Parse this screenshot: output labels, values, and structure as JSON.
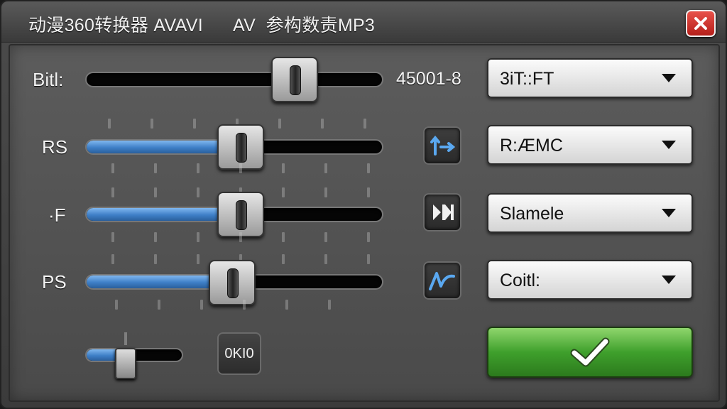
{
  "window": {
    "title": "动漫360转换器 AVAVI      AV  参构数责MP3",
    "close_icon": "close-x-icon"
  },
  "rows": [
    {
      "label": "Bitl:",
      "slider_level": 0.62,
      "has_fill": false
    },
    {
      "label": "RS",
      "slider_level": 0.45,
      "has_fill": true
    },
    {
      "label": "·F",
      "slider_level": 0.45,
      "has_fill": true
    },
    {
      "label": "PS",
      "slider_level": 0.42,
      "has_fill": true
    }
  ],
  "bitrate_value": "45001-8",
  "icons": {
    "row2": "swap-arrows-icon",
    "row3": "skip-forward-icon",
    "row4": "waveform-icon"
  },
  "dropdowns": [
    {
      "value": "3iT::FT"
    },
    {
      "value": "R:ÆMC"
    },
    {
      "value": "Slamele"
    },
    {
      "value": "Coitl:"
    }
  ],
  "mini_slider": {
    "level": 0.45
  },
  "ok_small_label": "0KI0",
  "confirm": {
    "icon": "checkmark-icon"
  },
  "colors": {
    "accent_blue": "#3e7fc7",
    "confirm_green": "#3fa02c",
    "close_red": "#c9302a"
  }
}
